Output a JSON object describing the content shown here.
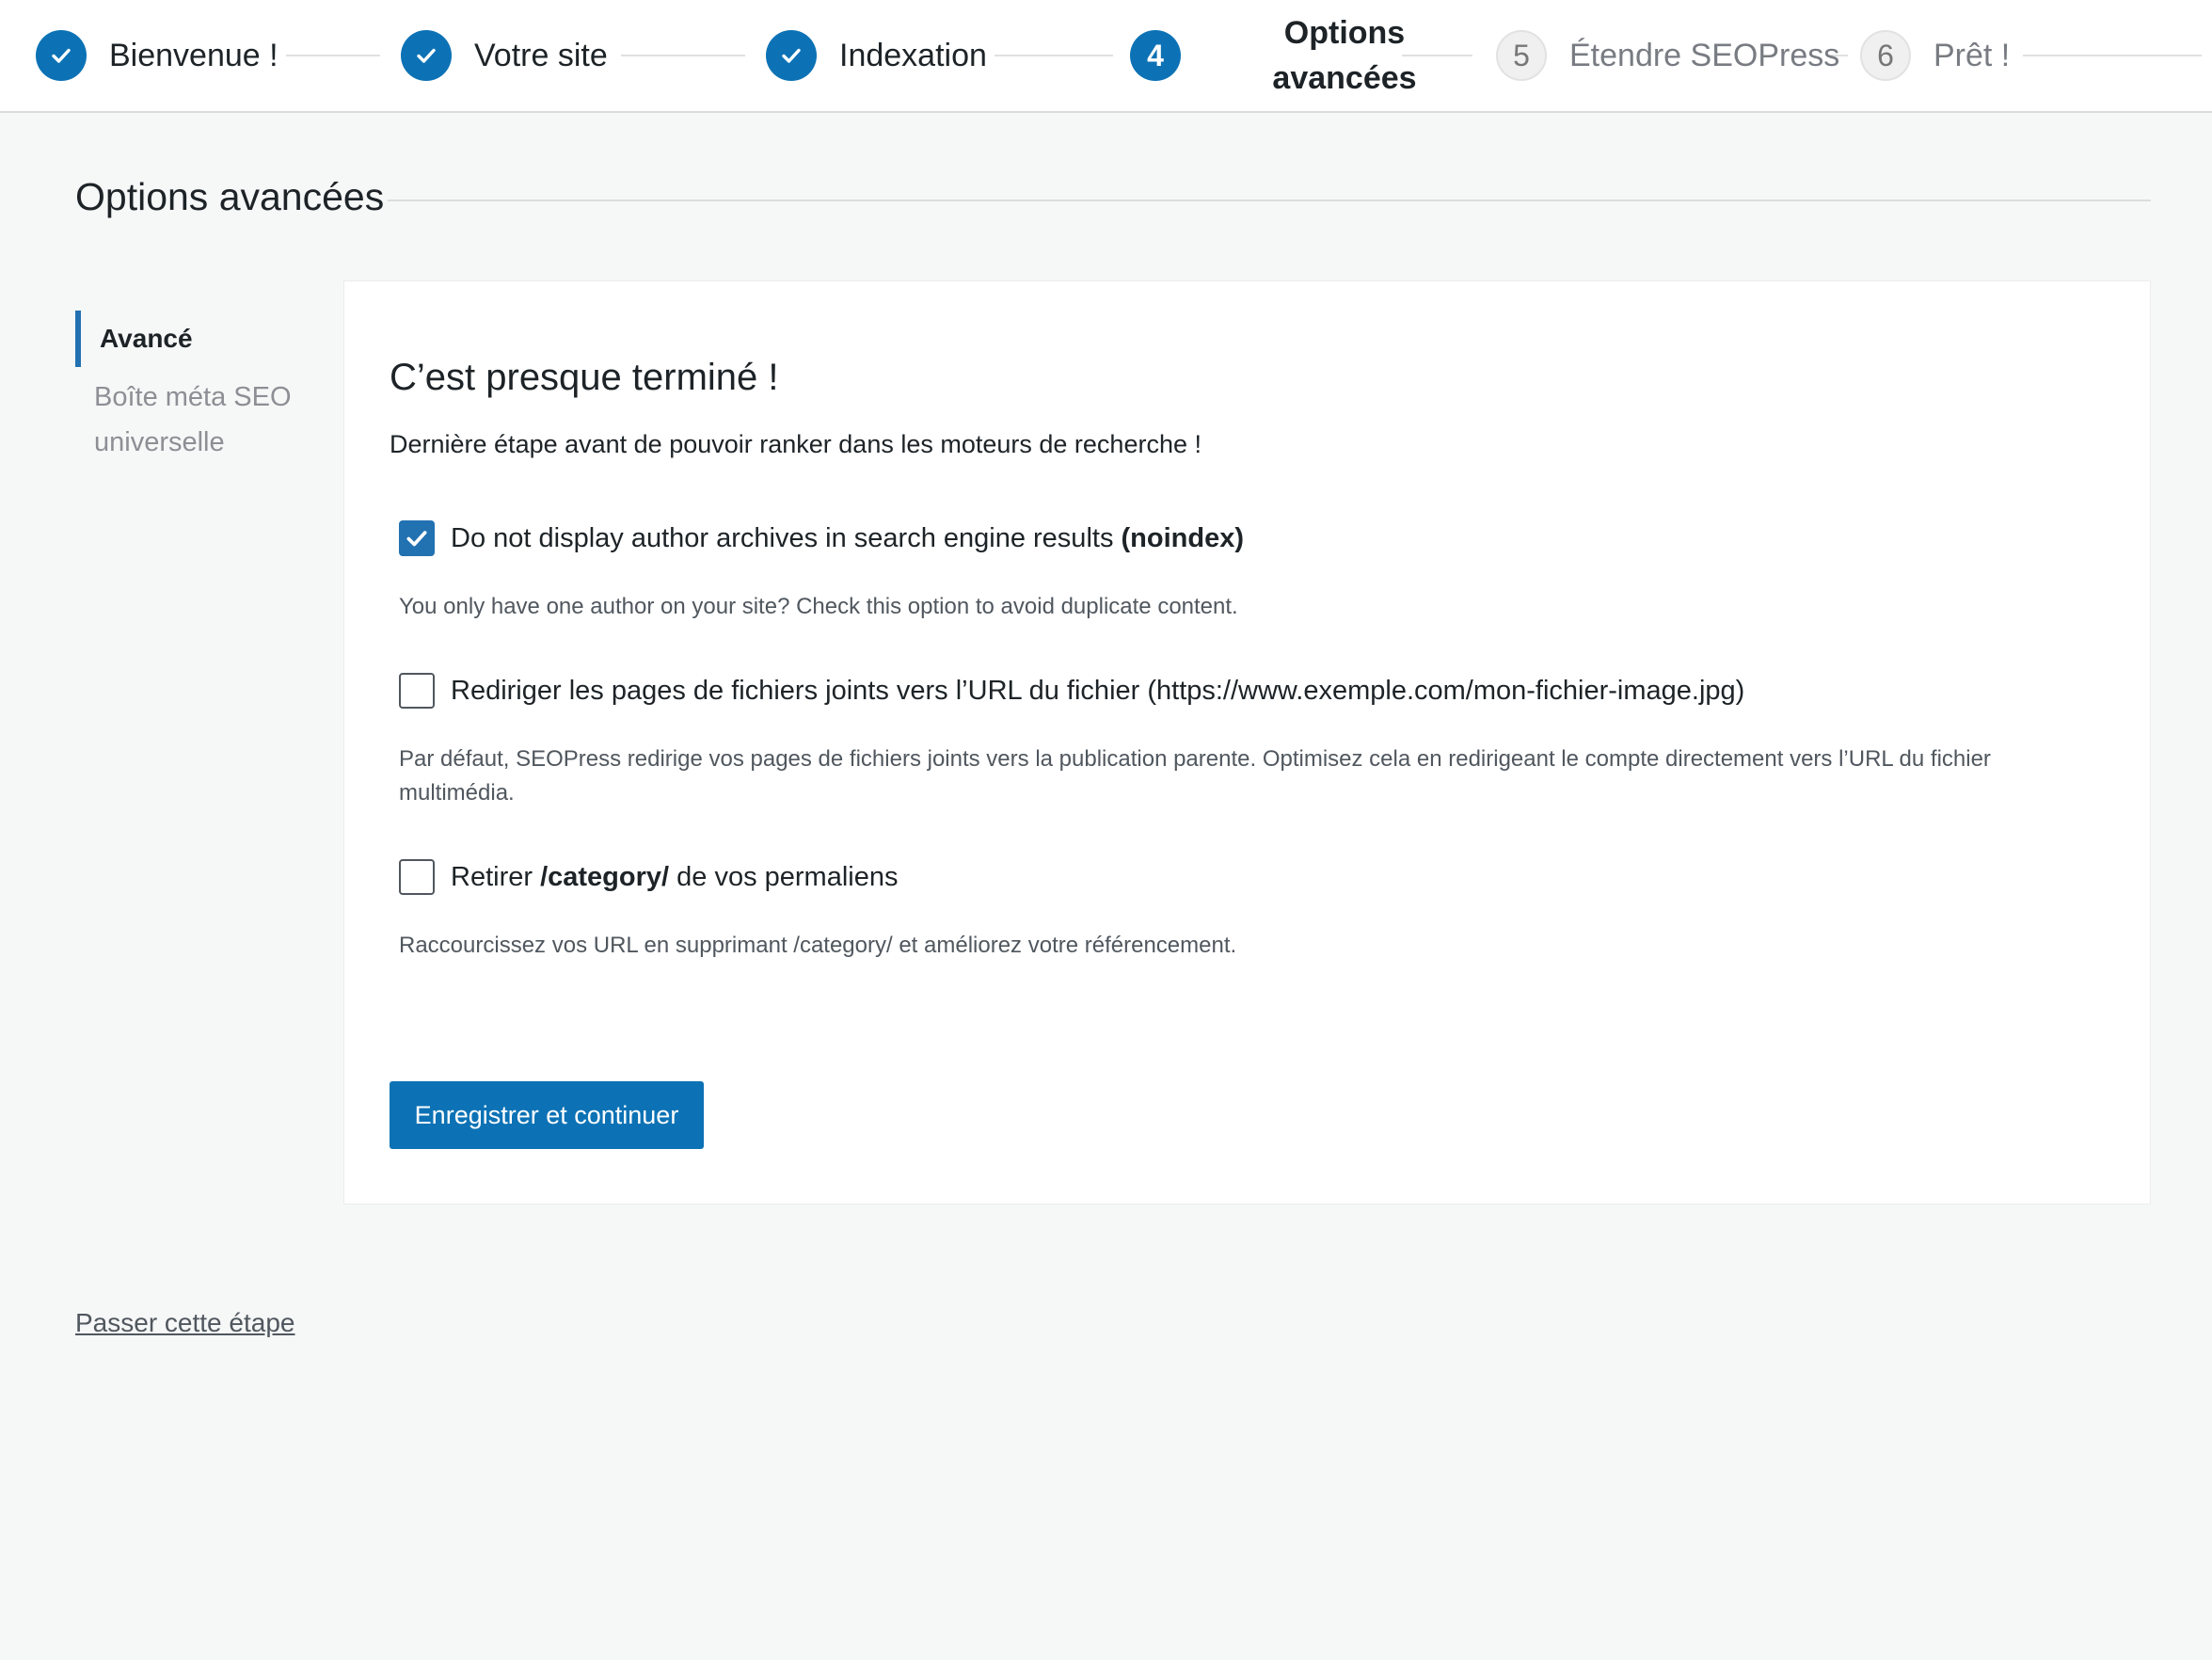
{
  "stepper": {
    "steps": [
      {
        "label": "Bienvenue !",
        "status": "done",
        "icon": "check-icon"
      },
      {
        "label": "Votre site",
        "status": "done",
        "icon": "check-icon"
      },
      {
        "label": "Indexation",
        "status": "done",
        "icon": "check-icon"
      },
      {
        "number": "4",
        "label": "Options avancées",
        "status": "current"
      },
      {
        "number": "5",
        "label": "Étendre SEOPress",
        "status": "todo"
      },
      {
        "number": "6",
        "label": "Prêt !",
        "status": "todo"
      }
    ]
  },
  "page": {
    "title": "Options avancées"
  },
  "side_nav": {
    "items": [
      {
        "label": "Avancé",
        "active": true
      },
      {
        "label": "Boîte méta SEO universelle",
        "active": false
      }
    ]
  },
  "panel": {
    "heading": "C’est presque terminé !",
    "subtitle": "Dernière étape avant de pouvoir ranker dans les moteurs de recherche !",
    "options": [
      {
        "checked": true,
        "label_prefix": "Do not display author archives in search engine results ",
        "label_bold": "(noindex)",
        "label_suffix": "",
        "description": "You only have one author on your site? Check this option to avoid duplicate content."
      },
      {
        "checked": false,
        "label_prefix": "Rediriger les pages de fichiers joints vers l’URL du fichier (https://www.exemple.com/mon-fichier-image.jpg)",
        "label_bold": "",
        "label_suffix": "",
        "description": "Par défaut, SEOPress redirige vos pages de fichiers joints vers la publication parente. Optimisez cela en redirigeant le compte directement vers l’URL du fichier multimédia."
      },
      {
        "checked": false,
        "label_prefix": "Retirer ",
        "label_bold": "/category/",
        "label_suffix": " de vos permaliens",
        "description": "Raccourcissez vos URL en supprimant /category/ et améliorez votre référencement."
      }
    ],
    "save_label": "Enregistrer et continuer"
  },
  "footer": {
    "skip_label": "Passer cette étape"
  },
  "colors": {
    "accent": "#2271b1",
    "step_done": "#0c72b5",
    "background": "#f6f7f7"
  }
}
